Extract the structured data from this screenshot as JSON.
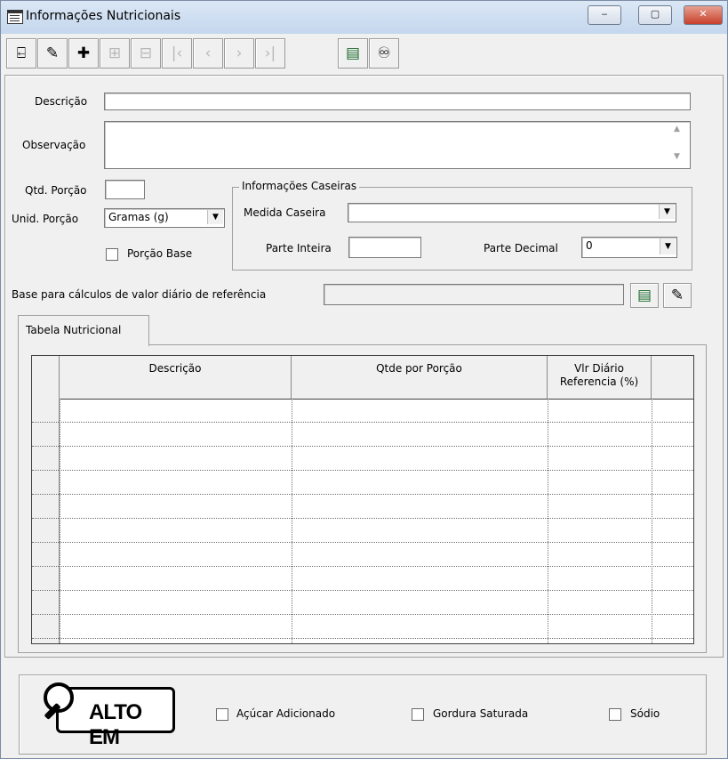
{
  "window": {
    "title": "Informações Nutricionais",
    "controls": {
      "minimize": "‒",
      "maximize": "▢",
      "close": "✕"
    }
  },
  "toolbar": {
    "buttons": [
      {
        "name": "exit-button",
        "icon": "exit-door-icon",
        "glyph": "⍇",
        "enabled": true
      },
      {
        "name": "edit-button",
        "icon": "pencil-icon",
        "glyph": "✎",
        "enabled": true
      },
      {
        "name": "new-button",
        "icon": "new-folder-icon",
        "glyph": "✚",
        "enabled": true
      },
      {
        "name": "insert-button",
        "icon": "insert-record-icon",
        "glyph": "⊞",
        "enabled": false
      },
      {
        "name": "delete-button",
        "icon": "delete-record-icon",
        "glyph": "⊟",
        "enabled": false
      },
      {
        "name": "first-button",
        "icon": "first-record-icon",
        "glyph": "|‹",
        "enabled": false
      },
      {
        "name": "prev-button",
        "icon": "prev-record-icon",
        "glyph": "‹",
        "enabled": false
      },
      {
        "name": "next-button",
        "icon": "next-record-icon",
        "glyph": "›",
        "enabled": false
      },
      {
        "name": "last-button",
        "icon": "last-record-icon",
        "glyph": "›|",
        "enabled": false
      },
      {
        "name": "list-button",
        "icon": "list-icon",
        "glyph": "▤",
        "enabled": true
      },
      {
        "name": "search-button",
        "icon": "binoculars-icon",
        "glyph": "♾",
        "enabled": true
      }
    ]
  },
  "form": {
    "descricao_label": "Descrição",
    "descricao_value": "",
    "observacao_label": "Observação",
    "observacao_value": "",
    "qtd_porcao_label": "Qtd. Porção",
    "qtd_porcao_value": "",
    "unid_porcao_label": "Unid. Porção",
    "unid_porcao_value": "Gramas (g)",
    "porcao_base_label": "Porção Base",
    "porcao_base_checked": false,
    "base_calc_label": "Base para cálculos de valor diário de referência",
    "base_calc_value": ""
  },
  "caseiras": {
    "title": "Informações Caseiras",
    "medida_label": "Medida Caseira",
    "medida_value": "",
    "parte_inteira_label": "Parte Inteira",
    "parte_inteira_value": "",
    "parte_decimal_label": "Parte Decimal",
    "parte_decimal_value": "0"
  },
  "tabs": [
    {
      "label": "Tabela Nutricional"
    }
  ],
  "grid": {
    "columns": [
      "Descrição",
      "Qtde por Porção",
      "Vlr Diário\nReferencia (%)"
    ],
    "row_count": 10
  },
  "alto_em": {
    "logo_text": "ALTO EM",
    "options": [
      {
        "label": "Açúcar Adicionado",
        "checked": false
      },
      {
        "label": "Gordura Saturada",
        "checked": false
      },
      {
        "label": "Sódio",
        "checked": false
      }
    ]
  },
  "colors": {
    "titlebar": "#c4d7ee",
    "close": "#c7402a",
    "face": "#f0f0f0"
  }
}
